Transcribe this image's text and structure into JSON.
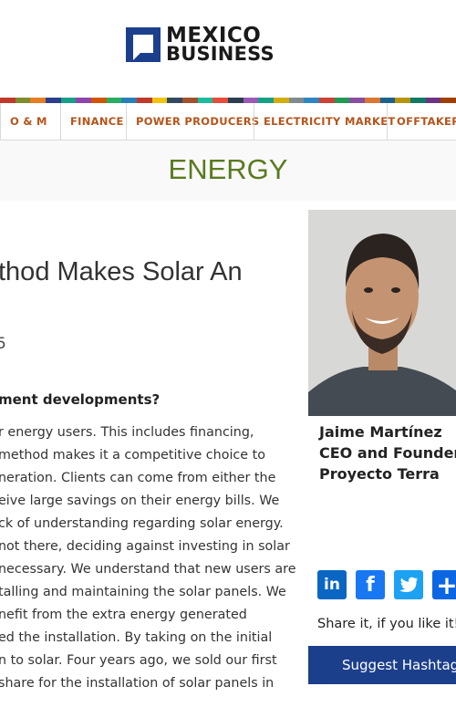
{
  "header": {
    "logo_line1": "MEXICO",
    "logo_line2": "BUSINESS",
    "brand_color": "#1c3f8c"
  },
  "colorbar": [
    "#c0392b",
    "#7f8c2d",
    "#e67e22",
    "#2c3e8c",
    "#16a085",
    "#8e44ad",
    "#d35400",
    "#27ae60",
    "#2980b9",
    "#c0392b",
    "#f1c40f",
    "#34495e",
    "#a0522d",
    "#1abc9c",
    "#e74c3c",
    "#2c3e50",
    "#9b59b6",
    "#16a085",
    "#d4ac0d",
    "#7f8c8d",
    "#2e86c1",
    "#cb4335",
    "#229954",
    "#884ea0",
    "#dc7633",
    "#1f618d",
    "#b7950b",
    "#117a65",
    "#6c3483",
    "#a04000"
  ],
  "nav": {
    "items": [
      {
        "label": "O & M"
      },
      {
        "label": "FINANCE"
      },
      {
        "label": "POWER PRODUCERS"
      },
      {
        "label": "ELECTRICITY MARKET"
      },
      {
        "label": "OFFTAKERS"
      }
    ],
    "color": "#b5541a"
  },
  "section": {
    "title": "ENERGY",
    "color": "#5a7a1e"
  },
  "article": {
    "title_fragment": "thod Makes Solar An",
    "date_fragment": "5",
    "question_fragment": "ment developments?",
    "paragraph_lines": [
      "r energy users. This includes financing,",
      "method makes it a competitive choice to",
      "neration. Clients can come from either the",
      "eive large savings on their energy bills. We",
      "ck of understanding regarding solar energy.",
      " not there, deciding against investing in solar",
      "necessary. We understand that new users are",
      "talling and maintaining the solar panels. We",
      "nefit from the extra energy generated",
      "ed the installation. By taking on the initial",
      "n to solar. Four years ago, we sold our first",
      "share for the installation of solar panels in"
    ]
  },
  "profile": {
    "name": "Jaime Martínez",
    "role": "CEO and Founder",
    "company": "Proyecto Terra"
  },
  "share": {
    "icons": [
      {
        "name": "linkedin-icon",
        "glyph": "in",
        "color": "#0a66c2"
      },
      {
        "name": "facebook-icon",
        "glyph": "f",
        "color": "#1877f2"
      },
      {
        "name": "twitter-icon",
        "glyph": "t",
        "color": "#1da1f2"
      },
      {
        "name": "add-share-icon",
        "glyph": "+",
        "color": "#0b66e4"
      }
    ],
    "text": "Share it, if you like it!"
  },
  "suggest_button": {
    "label": "Suggest Hashtag"
  }
}
